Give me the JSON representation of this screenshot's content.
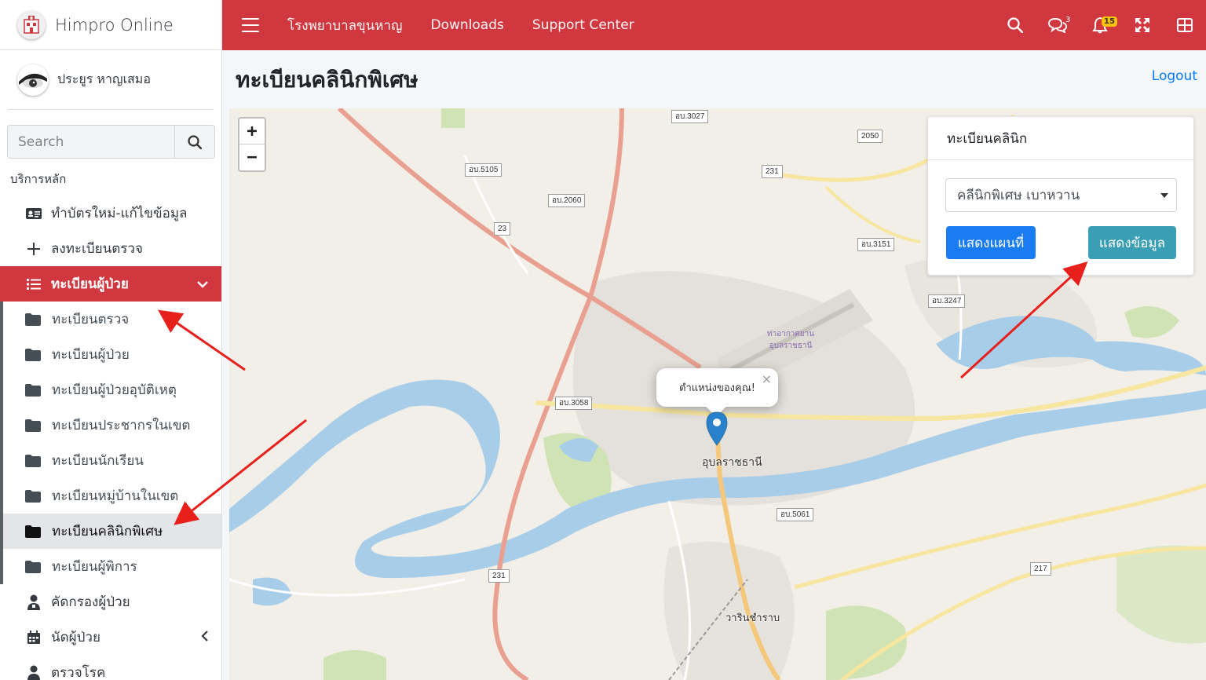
{
  "brand": {
    "title": "Himpro Online"
  },
  "user": {
    "name": "ประยูร หาญเสมอ"
  },
  "search": {
    "placeholder": "Search"
  },
  "sidebar": {
    "header": "บริการหลัก",
    "items": [
      {
        "label": "ทำบัตรใหม่-แก้ไขข้อมูล",
        "icon": "id-card-icon"
      },
      {
        "label": "ลงทะเบียนตรวจ",
        "icon": "plus-icon"
      },
      {
        "label": "ทะเบียนผู้ป่วย",
        "icon": "list-icon",
        "active": true
      }
    ],
    "subitems": [
      {
        "label": "ทะเบียนตรวจ"
      },
      {
        "label": "ทะเบียนผู้ป่วย"
      },
      {
        "label": "ทะเบียนผู้ป่วยอุบัติเหตุ"
      },
      {
        "label": "ทะเบียนประชากรในเขต"
      },
      {
        "label": "ทะเบียนนักเรียน"
      },
      {
        "label": "ทะเบียนหมู่บ้านในเขต"
      },
      {
        "label": "ทะเบียนคลินิกพิเศษ",
        "current": true
      },
      {
        "label": "ทะเบียนผู้พิการ"
      }
    ],
    "after": [
      {
        "label": "คัดกรองผู้ป่วย",
        "icon": "user-md-icon"
      },
      {
        "label": "นัดผู้ป่วย",
        "icon": "calendar-icon"
      },
      {
        "label": "ตรวจโรค",
        "icon": "doctor-icon"
      }
    ]
  },
  "topbar": {
    "links": [
      "โรงพยาบาลขุนหาญ",
      "Downloads",
      "Support Center"
    ],
    "messages_count": "3",
    "notifications_count": "15"
  },
  "content": {
    "title": "ทะเบียนคลินิกพิเศษ",
    "logout": "Logout"
  },
  "map": {
    "popup_text": "ตำแหน่งของคุณ!",
    "city": "อุบลราชธานี",
    "city2": "วารินชำราบ",
    "airport": "ท่าอากาศยานอุบลราชธานี",
    "shields": [
      "อบ.3027",
      "2050",
      "อบ.5105",
      "231",
      "อบ.2060",
      "23",
      "อบ.3151",
      "อบ.3247",
      "อบ.3058",
      "อบ.5061",
      "231",
      "217"
    ]
  },
  "panel": {
    "title": "ทะเบียนคลินิก",
    "selected": "คลีนิกพิเศษ เบาหวาน",
    "btn_map": "แสดงแผนที่",
    "btn_data": "แสดงข้อมูล"
  },
  "colors": {
    "primary": "#d0373f",
    "blue": "#1a7cf2",
    "teal": "#3a9fb4"
  }
}
